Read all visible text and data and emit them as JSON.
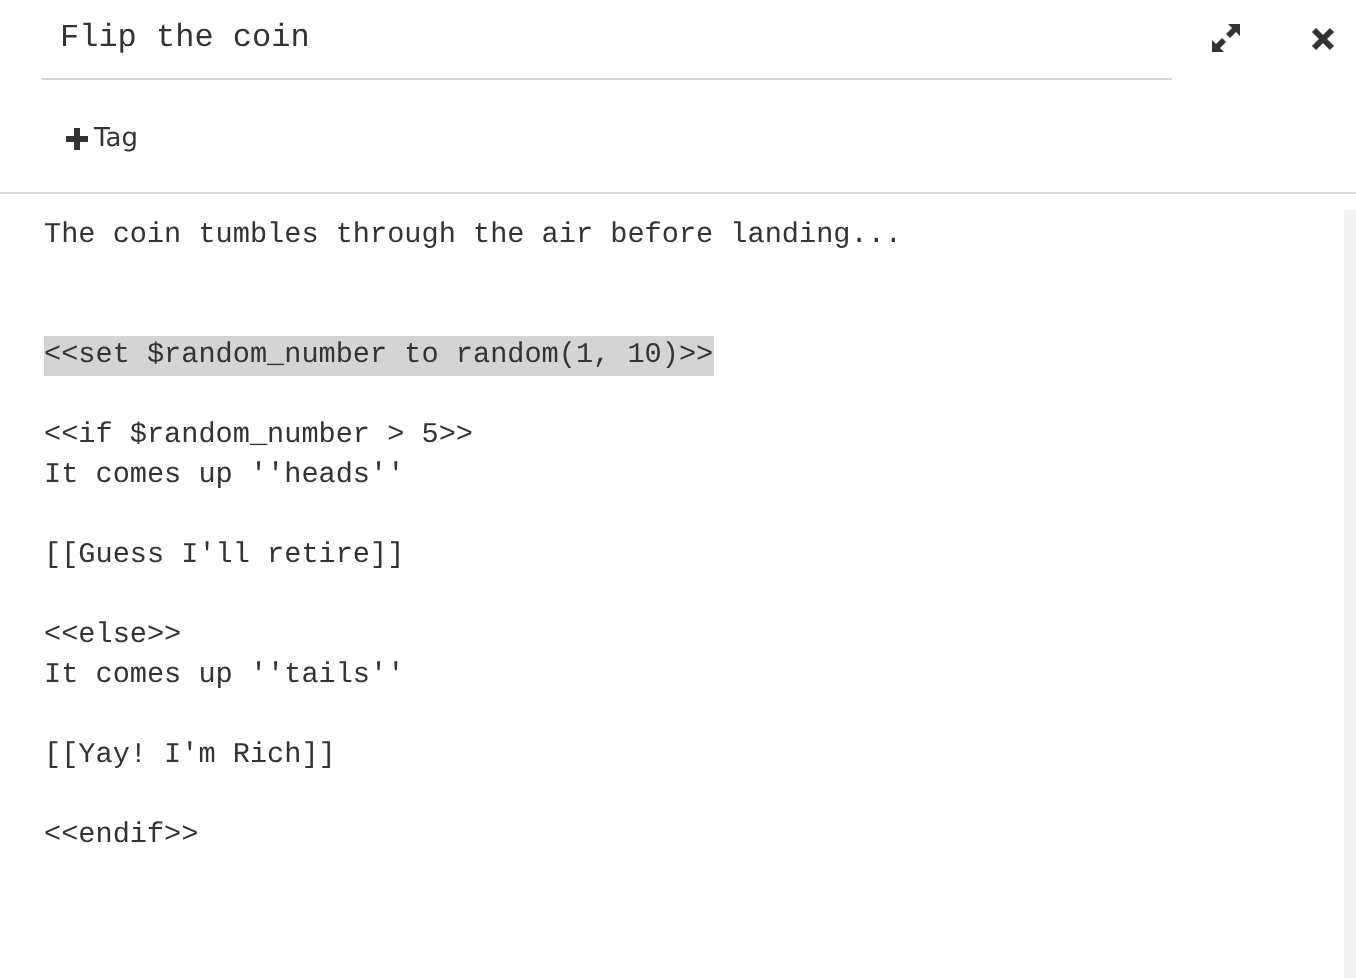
{
  "passage": {
    "title": "Flip the coin"
  },
  "toolbar": {
    "tag_button": "Tag"
  },
  "editor": {
    "lines": [
      {
        "kind": "text",
        "text": "The coin tumbles through the air before landing...",
        "selected": false
      },
      {
        "kind": "blank"
      },
      {
        "kind": "blank"
      },
      {
        "kind": "text",
        "text": "<<set $random_number to random(1, 10)>>",
        "selected": true
      },
      {
        "kind": "blank"
      },
      {
        "kind": "text",
        "text": "<<if $random_number > 5>>",
        "selected": false
      },
      {
        "kind": "text",
        "text": "It comes up ''heads''",
        "selected": false
      },
      {
        "kind": "blank"
      },
      {
        "kind": "text",
        "text": "[[Guess I'll retire]]",
        "selected": false
      },
      {
        "kind": "blank"
      },
      {
        "kind": "text",
        "text": "<<else>>",
        "selected": false
      },
      {
        "kind": "text",
        "text": "It comes up ''tails''",
        "selected": false
      },
      {
        "kind": "blank"
      },
      {
        "kind": "text",
        "text": "[[Yay! I'm Rich]]",
        "selected": false
      },
      {
        "kind": "blank"
      },
      {
        "kind": "text",
        "text": "<<endif>>",
        "selected": false
      }
    ]
  }
}
